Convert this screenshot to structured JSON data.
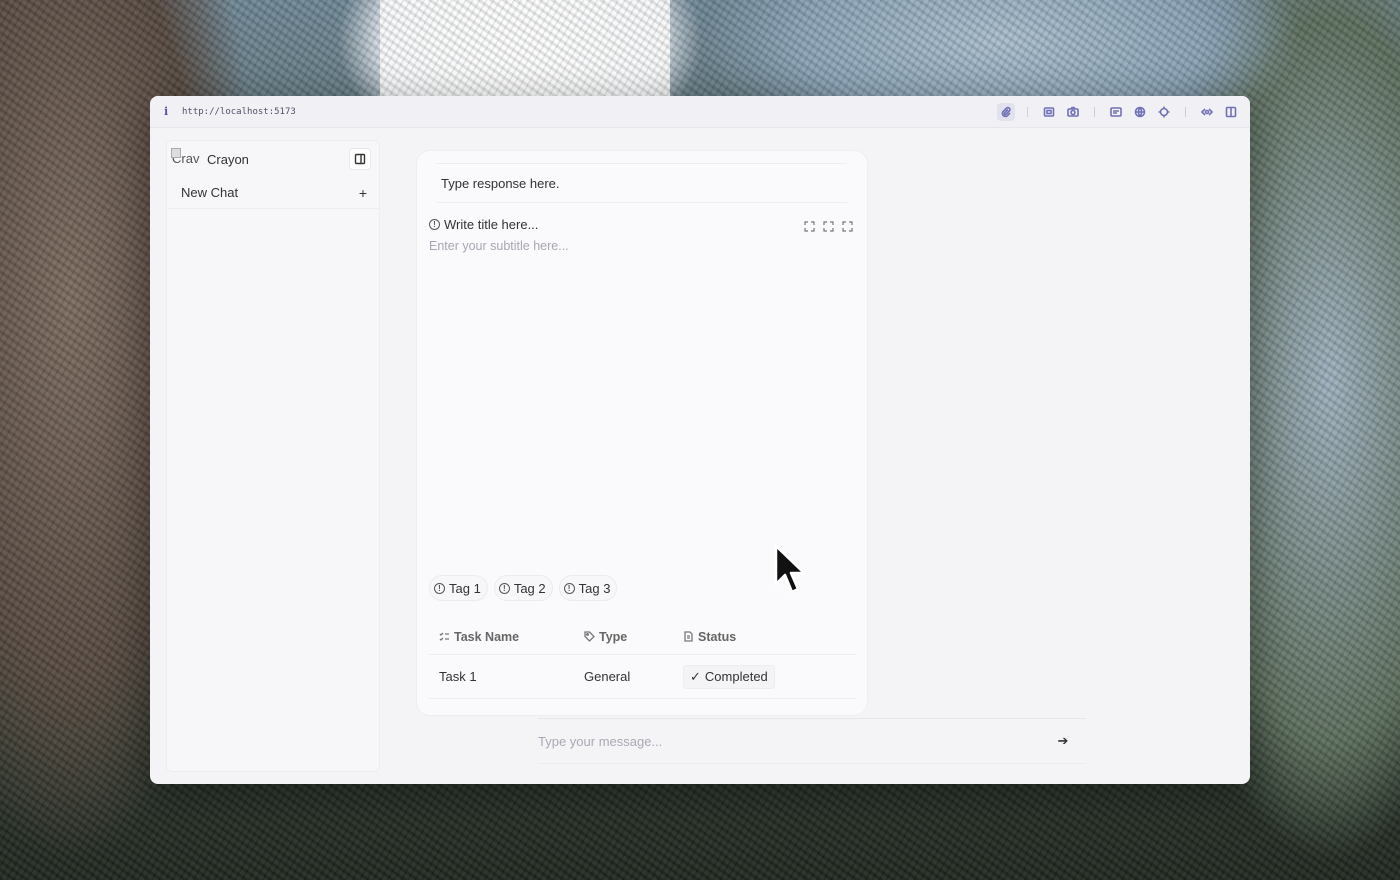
{
  "browser": {
    "url": "http://localhost:5173",
    "tools": [
      "paperclip-icon",
      "screenshot-icon",
      "camera-icon",
      "message-icon",
      "globe-icon",
      "target-icon",
      "code-icon",
      "split-view-icon"
    ]
  },
  "sidebar": {
    "brand_alt": "Crav",
    "brand_name": "Crayon",
    "new_chat_label": "New Chat",
    "new_chat_icon": "+"
  },
  "card": {
    "response_text": "Type response here.",
    "title": "Write title here...",
    "subtitle_placeholder": "Enter your subtitle here...",
    "tags": [
      {
        "label": "Tag 1"
      },
      {
        "label": "Tag 2"
      },
      {
        "label": "Tag 3"
      }
    ],
    "table": {
      "headers": [
        "Task Name",
        "Type",
        "Status"
      ],
      "rows": [
        {
          "task": "Task 1",
          "type": "General",
          "status": "Completed"
        }
      ]
    }
  },
  "composer": {
    "placeholder": "Type your message...",
    "send_icon": "arrow-right-icon"
  },
  "colors": {
    "accent": "#7070b8",
    "window_bg": "#f4f4f7"
  }
}
